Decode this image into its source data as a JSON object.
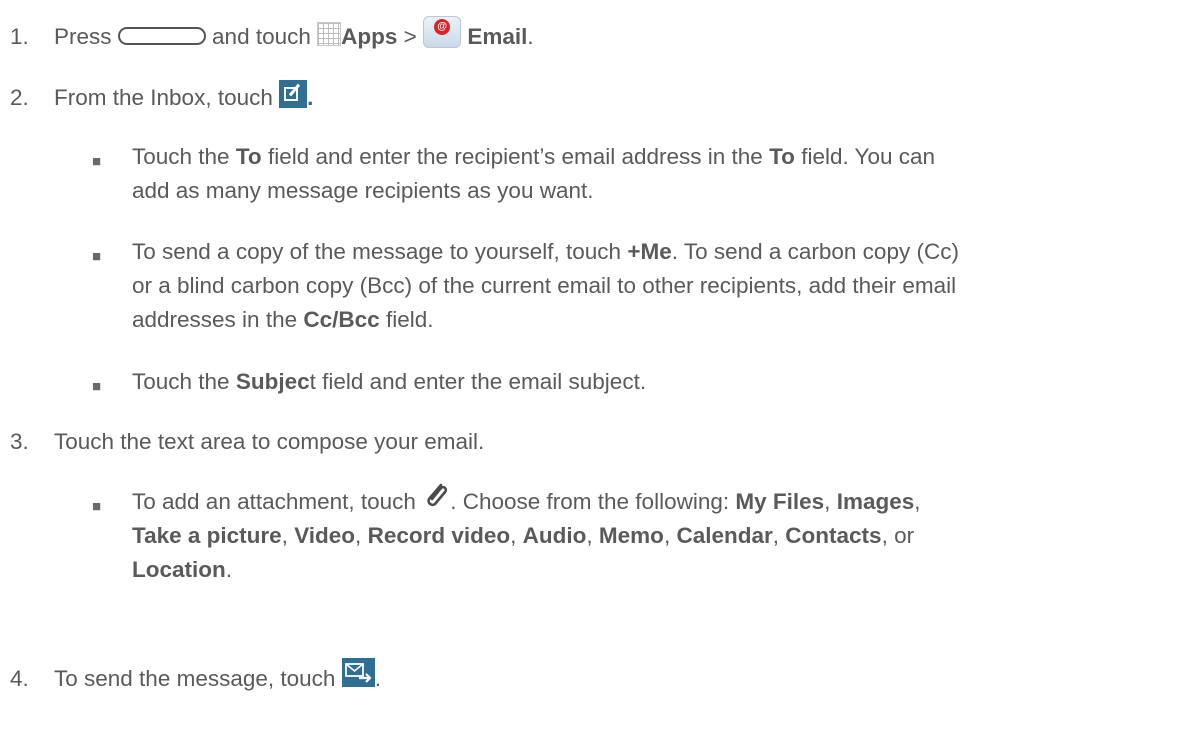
{
  "steps": [
    {
      "num": "1.",
      "a": "Press",
      "b": "and touch",
      "apps": "Apps",
      "gt": ">",
      "email": "Email",
      "end": "."
    },
    {
      "num": "2.",
      "text": "From the Inbox, touch",
      "end": "."
    },
    {
      "num": "3.",
      "text": "Touch the text area to compose your email."
    },
    {
      "num": "4.",
      "text": "To send the message, touch",
      "end": "."
    }
  ],
  "bullets": {
    "to": {
      "a": "Touch the",
      "to1": "To",
      "b": "field and enter the recipient’s email address in the",
      "to2": "To",
      "c": "field. You can",
      "line2": "add as many message recipients as you want."
    },
    "cc": {
      "a": "To send a copy of the message to yourself, touch",
      "me": "+Me",
      "b": ". To send a carbon copy (Cc)",
      "line2": "or a blind carbon copy (Bcc) of the current email to other recipients, add their email",
      "line3a": "addresses in the",
      "ccbcc": "Cc/Bcc",
      "line3b": "field."
    },
    "subject": {
      "a": "Touch the",
      "subj": "Subjec",
      "b": "t field and enter the email subject."
    },
    "attach": {
      "a": "To add an attachment, touch",
      "b": ". Choose from the following:",
      "myfiles": "My Files",
      "images": "Images",
      "take": "Take a picture",
      "video": "Video",
      "record": "Record video",
      "audio": "Audio",
      "memo": "Memo",
      "calendar": "Calendar",
      "contacts": "Contacts",
      "or": "or",
      "location": "Location",
      "end": ".",
      "comma": ","
    }
  },
  "bullet_glyph": "■",
  "icons": [
    "home-key-icon",
    "apps-grid-icon",
    "email-app-icon",
    "compose-icon",
    "paperclip-icon",
    "send-icon"
  ]
}
